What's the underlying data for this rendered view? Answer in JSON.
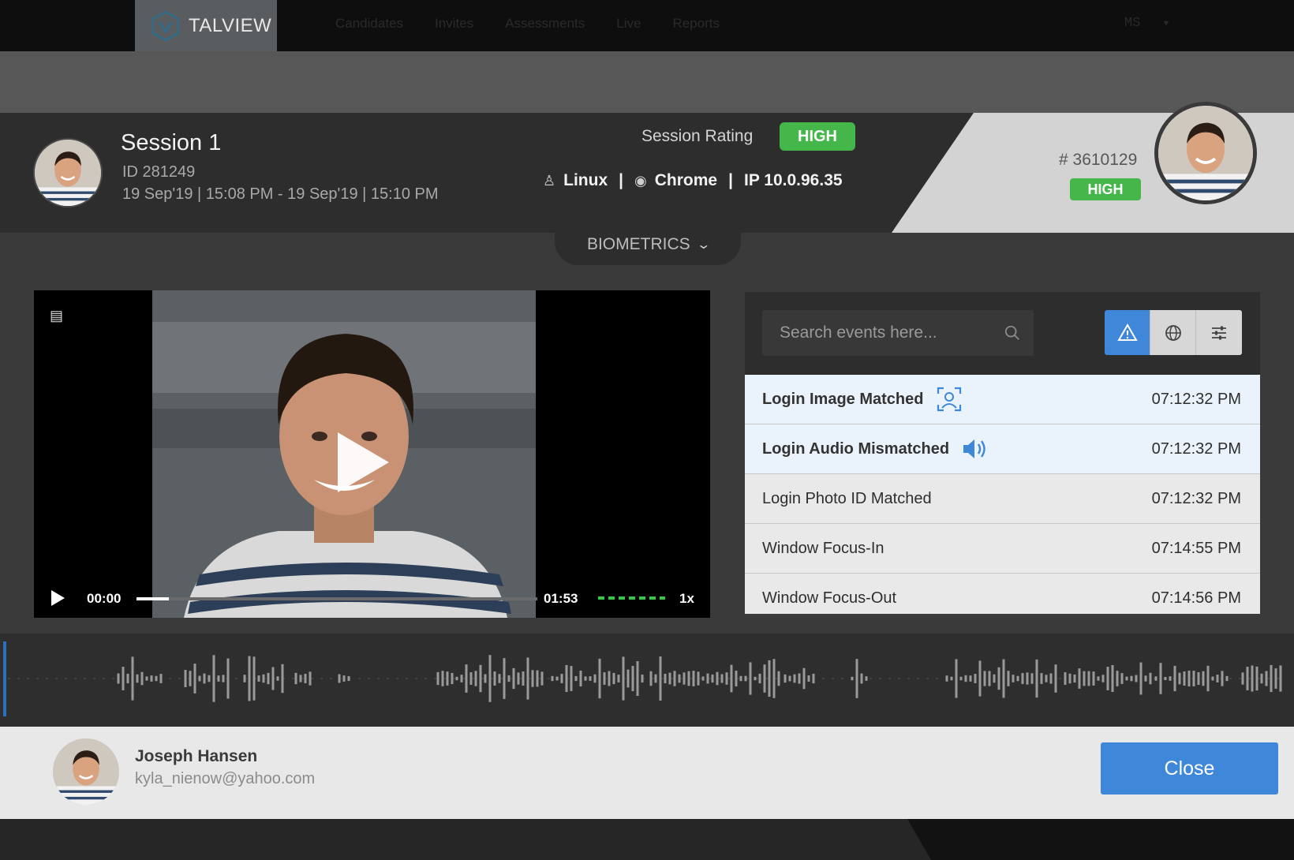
{
  "nav": {
    "logo_text": "TALVIEW",
    "items": [
      "Candidates",
      "Invites",
      "Assessments",
      "Live",
      "Reports"
    ],
    "user_initials": "MS"
  },
  "session": {
    "title": "Session 1",
    "id": "ID 281249",
    "time_range": "19 Sep'19 | 15:08 PM - 19 Sep'19 | 15:10 PM",
    "rating_label": "Session Rating",
    "rating": "HIGH",
    "os": "Linux",
    "browser": "Chrome",
    "ip": "IP 10.0.96.35",
    "separator": "|"
  },
  "candidate": {
    "number": "# 3610129",
    "rating": "HIGH",
    "name": "Joseph Hansen",
    "email": "kyla_nienow@yahoo.com"
  },
  "biometrics": {
    "label": "BIOMETRICS"
  },
  "player": {
    "current_time": "00:00",
    "duration": "01:53",
    "speed": "1x",
    "progress_fraction": 0.08
  },
  "events_panel": {
    "search_placeholder": "Search events here...",
    "active_filter": "alerts",
    "events": [
      {
        "name": "Login Image Matched",
        "time": "07:12:32 PM",
        "icon": "face-scan-icon"
      },
      {
        "name": "Login Audio Mismatched",
        "time": "07:12:32 PM",
        "icon": "speaker-icon"
      },
      {
        "name": "Login Photo ID Matched",
        "time": "07:12:32 PM"
      },
      {
        "name": "Window Focus-In",
        "time": "07:14:55 PM"
      },
      {
        "name": "Window Focus-Out",
        "time": "07:14:56 PM"
      }
    ]
  },
  "footer": {
    "close_label": "Close"
  },
  "colors": {
    "accent_blue": "#3f87d8",
    "badge_green": "#45b649",
    "wave_marker": "#2f6fc2"
  }
}
